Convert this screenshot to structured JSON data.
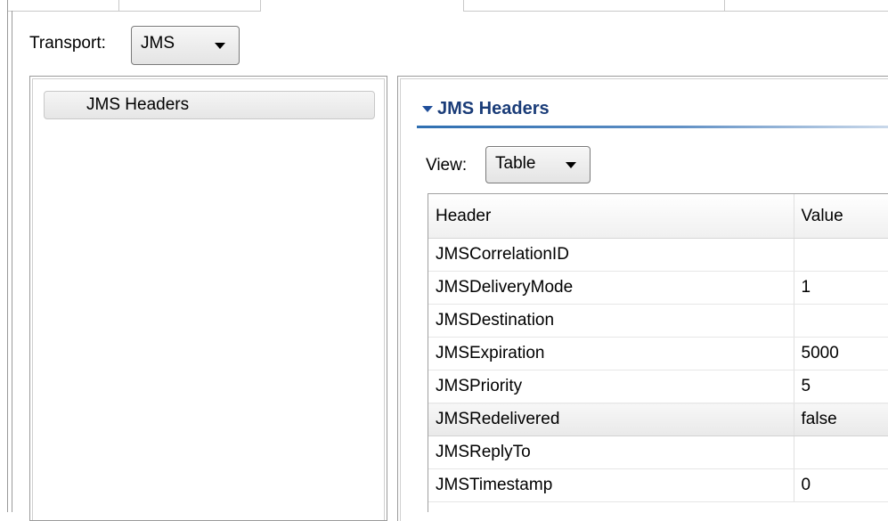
{
  "transport": {
    "label": "Transport:",
    "selected": "JMS"
  },
  "nav": {
    "items": [
      {
        "label": "JMS Headers"
      }
    ]
  },
  "section": {
    "title": "JMS Headers"
  },
  "view": {
    "label": "View:",
    "selected": "Table"
  },
  "table": {
    "columns": [
      "Header",
      "Value"
    ],
    "rows": [
      {
        "header": "JMSCorrelationID",
        "value": ""
      },
      {
        "header": "JMSDeliveryMode",
        "value": "1"
      },
      {
        "header": "JMSDestination",
        "value": ""
      },
      {
        "header": "JMSExpiration",
        "value": "5000"
      },
      {
        "header": "JMSPriority",
        "value": "5"
      },
      {
        "header": "JMSRedelivered",
        "value": "false"
      },
      {
        "header": "JMSReplyTo",
        "value": ""
      },
      {
        "header": "JMSTimestamp",
        "value": "0"
      }
    ],
    "selected_row": "JMSRedelivered"
  },
  "colors": {
    "section_title": "#1a3c78",
    "section_rule": "#2f6fb1"
  },
  "icons": {
    "dropdown": "chevron-down-icon",
    "section_toggle": "triangle-down-icon"
  }
}
